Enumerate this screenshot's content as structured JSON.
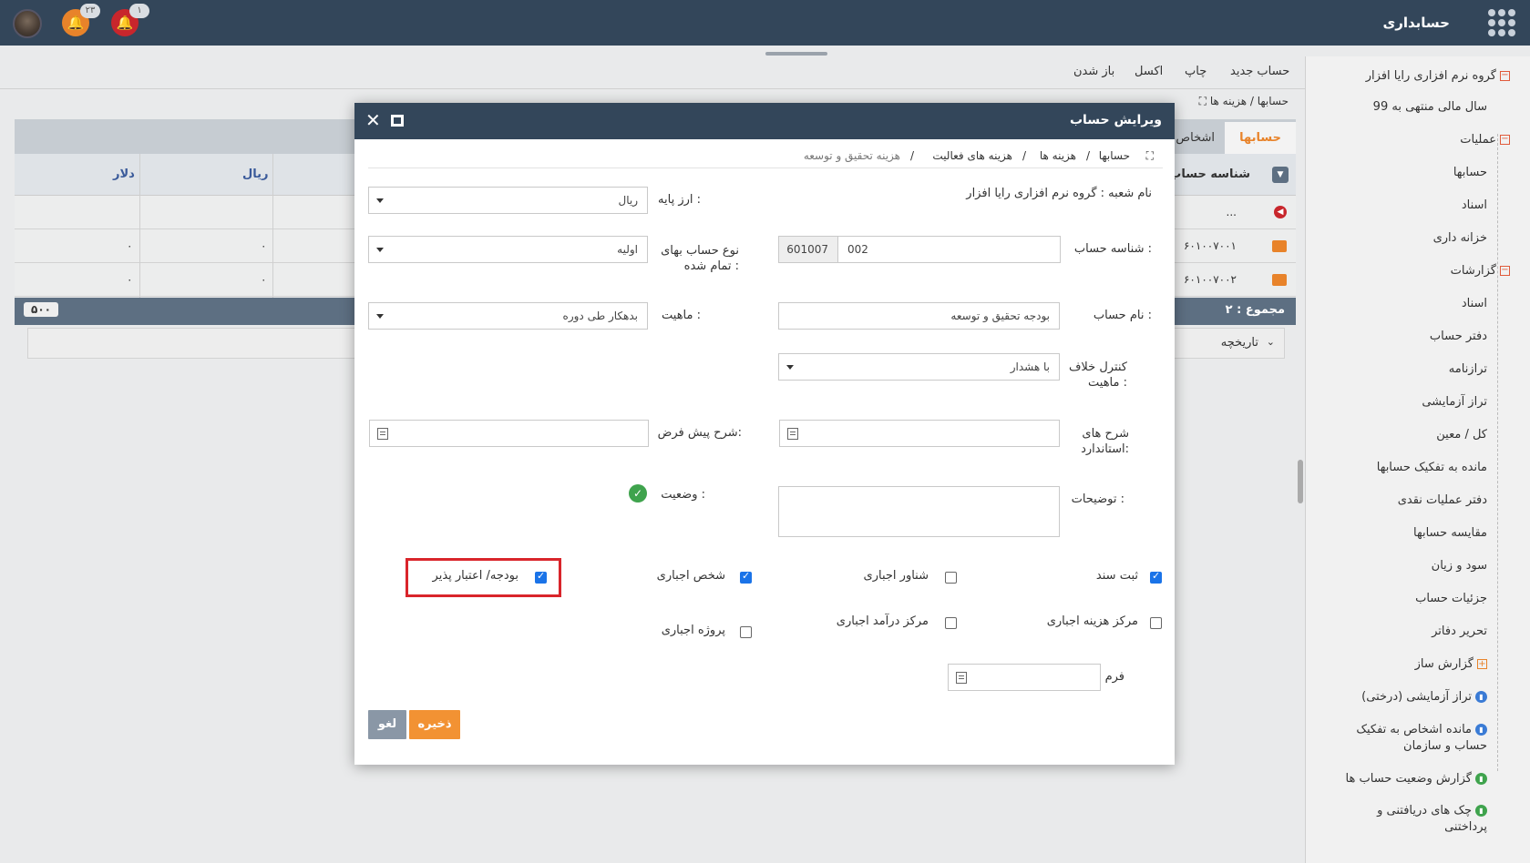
{
  "app": {
    "title": "حسابداری"
  },
  "notifications": {
    "orange_count": "۲۳",
    "red_count": "۱"
  },
  "toolbar": {
    "new_account": "حساب جدید",
    "print": "چاپ",
    "excel": "اکسل",
    "open": "باز شدن"
  },
  "bg_breadcrumb": {
    "text": "حسابها  /  هزینه ها"
  },
  "tabs": {
    "accounts": "حسابها",
    "persons": "اشخاص"
  },
  "grid": {
    "headers": {
      "id": "شناسه حساب",
      "rial": "ریال",
      "dollar": "دلار"
    },
    "rows": [
      {
        "id": "...",
        "rial": "",
        "dollar": ""
      },
      {
        "id": "۶۰۱۰۰۷۰۰۱",
        "rial": "۰",
        "dollar": "۰"
      },
      {
        "id": "۶۰۱۰۰۷۰۰۲",
        "rial": "۰",
        "dollar": "۰"
      }
    ],
    "footer": {
      "sum_label": "مجموع : ۲",
      "sum_value": "۵۰۰"
    },
    "history": "تاریخچه"
  },
  "sidebar": {
    "items": [
      {
        "label": "گروه نرم افزاری رایا افزار",
        "kind": "group-minus"
      },
      {
        "label": "سال مالی منتهی به 99",
        "kind": "item"
      },
      {
        "label": "عملیات",
        "kind": "group-minus"
      },
      {
        "label": "حسابها",
        "kind": "active"
      },
      {
        "label": "اسناد",
        "kind": "item"
      },
      {
        "label": "خزانه داری",
        "kind": "item"
      },
      {
        "label": "گزارشات",
        "kind": "group-minus"
      },
      {
        "label": "اسناد",
        "kind": "item"
      },
      {
        "label": "دفتر حساب",
        "kind": "item"
      },
      {
        "label": "ترازنامه",
        "kind": "item"
      },
      {
        "label": "تراز آزمایشی",
        "kind": "item"
      },
      {
        "label": "کل / معین",
        "kind": "item"
      },
      {
        "label": "مانده به تفکیک حسابها",
        "kind": "item"
      },
      {
        "label": "دفتر عملیات نقدی",
        "kind": "item"
      },
      {
        "label": "مقایسه حسابها",
        "kind": "item"
      },
      {
        "label": "سود و زیان",
        "kind": "item"
      },
      {
        "label": "جزئیات حساب",
        "kind": "item"
      },
      {
        "label": "تحریر دفاتر",
        "kind": "item"
      },
      {
        "label": "گزارش ساز",
        "kind": "group-plus"
      },
      {
        "label": "تراز آزمایشی (درختی)",
        "kind": "report-blue"
      },
      {
        "label": "مانده اشخاص به تفکیک",
        "label2": "حساب و سازمان",
        "kind": "report-blue"
      },
      {
        "label": "گزارش وضعیت حساب ها",
        "kind": "report-green"
      },
      {
        "label": "چک های دریافتنی و",
        "label2": "پرداختنی",
        "kind": "report-green"
      }
    ]
  },
  "modal": {
    "title": "ویرایش حساب",
    "breadcrumb": [
      "حسابها",
      "هزینه ها",
      "هزینه های فعالیت",
      "هزینه تحقیق و توسعه"
    ],
    "branch_label": "نام شعبه : گروه نرم افزاری رایا افزار",
    "base_currency": {
      "label": "ارز پایه :",
      "value": "ریال"
    },
    "account_id": {
      "label": "شناسه حساب :",
      "prefix": "601007",
      "value": "002"
    },
    "cost_type": {
      "label1": "نوع حساب بهای",
      "label2": "تمام شده :",
      "value": "اولیه"
    },
    "account_name": {
      "label": "نام حساب :",
      "value": "بودجه تحقیق و توسعه"
    },
    "nature": {
      "label": "ماهیت :",
      "value": "بدهکار طی دوره"
    },
    "nature_control": {
      "label1": "کنترل خلاف",
      "label2": "ماهیت :",
      "value": "با هشدار"
    },
    "default_desc": {
      "label": "شرح پیش فرض:",
      "value": ""
    },
    "standard_desc": {
      "label1": "شرح های",
      "label2": "استاندارد:",
      "value": ""
    },
    "notes": {
      "label": "توضیحات :",
      "value": ""
    },
    "status": {
      "label": "وضعیت :"
    },
    "checkboxes": {
      "register_doc": {
        "label": "ثبت سند",
        "checked": true
      },
      "floating_required": {
        "label": "شناور اجباری",
        "checked": false
      },
      "person_required": {
        "label": "شخص اجباری",
        "checked": true
      },
      "budget_credit": {
        "label": "بودجه/ اعتبار پذیر",
        "checked": true
      },
      "cost_center_required": {
        "label": "مرکز هزینه اجباری",
        "checked": false
      },
      "income_center_required": {
        "label": "مرکز درآمد اجباری",
        "checked": false
      },
      "project_required": {
        "label": "پروژه اجباری",
        "checked": false
      }
    },
    "form": {
      "label": "فرم",
      "value": ""
    },
    "buttons": {
      "save": "ذخیره",
      "cancel": "لغو"
    }
  },
  "colors": {
    "header": "#33465a",
    "accent": "#e8832a",
    "highlight": "#d9252b",
    "check": "#1a73e8"
  }
}
